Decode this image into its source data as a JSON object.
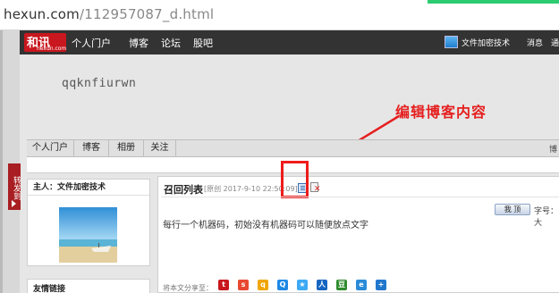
{
  "browser": {
    "url_host": "hexun.com",
    "url_path": "/112957087_d.html"
  },
  "topnav": {
    "logo_text": "和讯",
    "logo_sub": "hexun.com",
    "items": [
      "个人门户",
      "博客",
      "论坛",
      "股吧"
    ],
    "user_name": "文件加密技术",
    "messages": "消息",
    "more": "通"
  },
  "blog": {
    "title": "qqknfiurwn",
    "annotation": "编辑博客内容"
  },
  "tabs": [
    "个人门户",
    "博客",
    "相册",
    "关注"
  ],
  "tab_right_text": "博",
  "share_tab": "转发到",
  "sidebar": {
    "owner_label": "主人：文件加密技术",
    "links_label": "友情链接"
  },
  "post": {
    "title": "召回列表",
    "meta": "[原创 2017-9-10 22:50:09]",
    "hot_button": "我 顶",
    "font_size_label": "字号：大",
    "content": "每行一个机器码，初始没有机器码可以随便放点文字",
    "share_label": "将本文分享至："
  },
  "share_icons": [
    {
      "name": "hexun-share-icon",
      "color": "#c8171e",
      "glyph": "t"
    },
    {
      "name": "sina-share-icon",
      "color": "#e84830",
      "glyph": "s"
    },
    {
      "name": "tencent-share-icon",
      "color": "#f0a500",
      "glyph": "q"
    },
    {
      "name": "qq-zone-share-icon",
      "color": "#1e88e5",
      "glyph": "Q"
    },
    {
      "name": "star-share-icon",
      "color": "#3da9f5",
      "glyph": "★"
    },
    {
      "name": "renren-share-icon",
      "color": "#1565c0",
      "glyph": "人"
    },
    {
      "name": "douban-share-icon",
      "color": "#2e8b2e",
      "glyph": "豆"
    },
    {
      "name": "email-share-icon",
      "color": "#2a8bd8",
      "glyph": "e"
    },
    {
      "name": "plus-share-icon",
      "color": "#2277cc",
      "glyph": "+"
    }
  ],
  "colors": {
    "nav_bg": "#333333",
    "brand_red": "#c8171e",
    "annotation_red": "#e52020"
  }
}
